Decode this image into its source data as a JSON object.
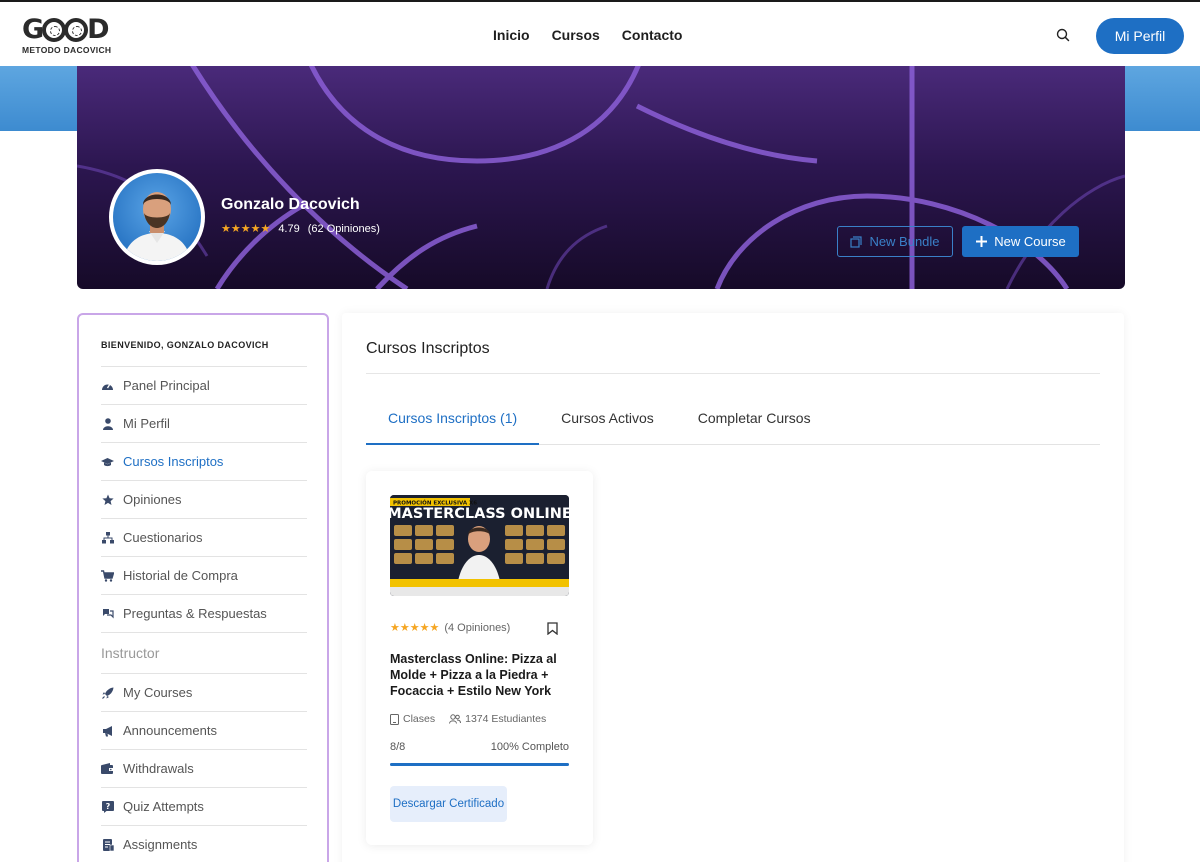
{
  "header": {
    "logo_word": "GOOD",
    "logo_sub": "METODO DACOVICH",
    "nav": [
      "Inicio",
      "Cursos",
      "Contacto"
    ],
    "profile_button": "Mi Perfil"
  },
  "profile": {
    "name": "Gonzalo Dacovich",
    "stars": "★★★★★",
    "rating": "4.79",
    "reviews": "(62 Opiniones)",
    "new_bundle": "New Bundle",
    "new_course": "New Course"
  },
  "sidebar": {
    "welcome": "BIENVENIDO, GONZALO DACOVICH",
    "items": [
      {
        "label": "Panel Principal",
        "icon": "dashboard-icon"
      },
      {
        "label": "Mi Perfil",
        "icon": "user-icon"
      },
      {
        "label": "Cursos Inscriptos",
        "icon": "graduation-cap-icon",
        "active": true
      },
      {
        "label": "Opiniones",
        "icon": "star-icon"
      },
      {
        "label": "Cuestionarios",
        "icon": "sitemap-icon"
      },
      {
        "label": "Historial de Compra",
        "icon": "cart-icon"
      },
      {
        "label": "Preguntas & Respuestas",
        "icon": "question-icon"
      }
    ],
    "section_label": "Instructor",
    "instructor_items": [
      {
        "label": "My Courses",
        "icon": "rocket-icon"
      },
      {
        "label": "Announcements",
        "icon": "megaphone-icon"
      },
      {
        "label": "Withdrawals",
        "icon": "wallet-icon"
      },
      {
        "label": "Quiz Attempts",
        "icon": "quiz-icon"
      },
      {
        "label": "Assignments",
        "icon": "assignment-icon"
      }
    ]
  },
  "main": {
    "title": "Cursos Inscriptos",
    "tabs": [
      "Cursos Inscriptos (1)",
      "Cursos Activos",
      "Completar Cursos"
    ],
    "active_tab": 0
  },
  "course": {
    "thumb_banner": "PROMOCIÓN EXCLUSIVA X6",
    "thumb_title": "MASTERCLASS ONLINE",
    "stars": "★★★★★",
    "reviews": "(4 Opiniones)",
    "title": "Masterclass Online: Pizza al Molde + Pizza a la Piedra + Focaccia + Estilo New York",
    "lessons_label": "Clases",
    "students": "1374 Estudiantes",
    "progress_count": "8/8",
    "progress_label": "100% Completo",
    "progress_fraction": 1.0,
    "certificate_button": "Descargar Certificado"
  },
  "colors": {
    "accent": "#1e6fc4",
    "sidebar_border": "#c9a6e8",
    "star": "#f5a623"
  }
}
